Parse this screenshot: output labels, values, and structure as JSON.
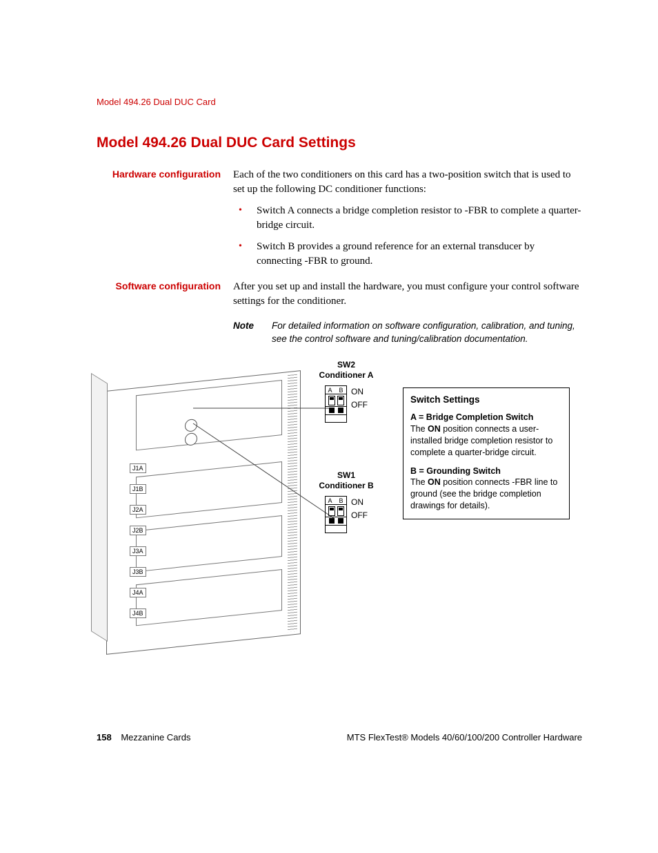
{
  "header": {
    "running": "Model 494.26 Dual DUC Card"
  },
  "title": "Model 494.26 Dual DUC Card Settings",
  "sections": {
    "hardware": {
      "label": "Hardware configuration",
      "intro": "Each of the two conditioners on this card has a two-position switch that is used to set up the following DC conditioner functions:",
      "bullets": [
        "Switch A connects a bridge completion resistor to -FBR to complete a quarter-bridge circuit.",
        "Switch B provides a ground reference for an external transducer by connecting -FBR to ground."
      ]
    },
    "software": {
      "label": "Software configuration",
      "intro": "After you set up and install the hardware, you must configure your control software settings for the conditioner.",
      "note_label": "Note",
      "note_text": "For detailed information on software configuration, calibration, and tuning, see the control software and tuning/calibration documentation."
    }
  },
  "diagram": {
    "connectors": [
      "J1A",
      "J1B",
      "J2A",
      "J2B",
      "J3A",
      "J3B",
      "J4A",
      "J4B"
    ],
    "sw2": {
      "title_line1": "SW2",
      "title_line2": "Conditioner A",
      "ab": "A B",
      "on": "ON",
      "off": "OFF"
    },
    "sw1": {
      "title_line1": "SW1",
      "title_line2": "Conditioner B",
      "ab": "A B",
      "on": "ON",
      "off": "OFF"
    },
    "infobox": {
      "heading": "Switch Settings",
      "a_title": "A = Bridge Completion Switch",
      "a_body_pre": "The ",
      "a_body_on": "ON",
      "a_body_post": " position connects a user-installed bridge completion resistor to complete a quarter-bridge circuit.",
      "b_title": "B = Grounding Switch",
      "b_body_pre": "The ",
      "b_body_on": "ON",
      "b_body_post": " position connects -FBR line to ground (see the bridge completion drawings for details)."
    }
  },
  "footer": {
    "page": "158",
    "section": "Mezzanine Cards",
    "doc": "MTS FlexTest® Models 40/60/100/200 Controller Hardware"
  }
}
